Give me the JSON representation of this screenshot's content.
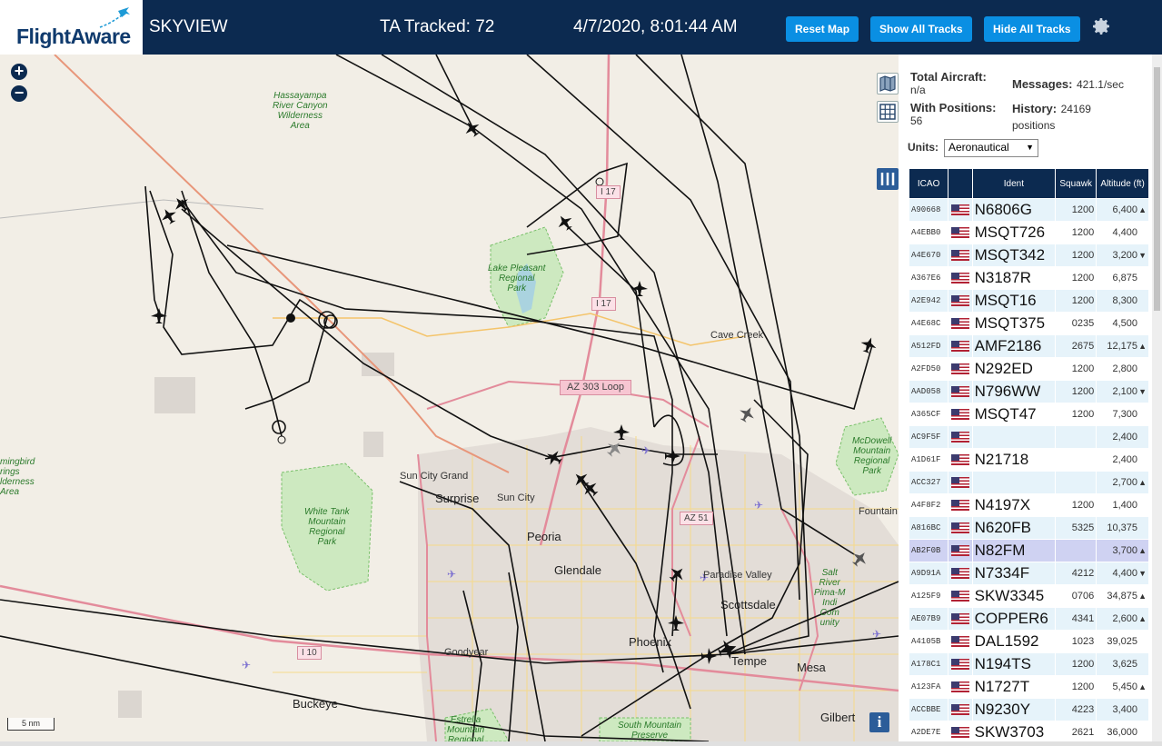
{
  "header": {
    "logo_text": "FlightAware",
    "app_title": "SKYVIEW",
    "tracked": "TA Tracked: 72",
    "clock": "4/7/2020, 8:01:44 AM",
    "reset_label": "Reset Map",
    "show_label": "Show All Tracks",
    "hide_label": "Hide All Tracks"
  },
  "map": {
    "scale_label": "5 nm",
    "info_label": "i",
    "labels": {
      "cave_creek": "Cave Creek",
      "sun_city_grand": "Sun City Grand",
      "surprise": "Surprise",
      "sun_city": "Sun City",
      "peoria": "Peoria",
      "glendale": "Glendale",
      "paradise_valley": "Paradise Valley",
      "scottsdale": "Scottsdale",
      "phoenix": "Phoenix",
      "tempe": "Tempe",
      "mesa": "Mesa",
      "goodyear": "Goodyear",
      "buckeye": "Buckeye",
      "gilbert": "Gilbert",
      "fountain": "Fountain",
      "hassayampa": "Hassayampa\nRiver Canyon\nWilderness\nArea",
      "lake_pleasant": "Lake Pleasant\nRegional\nPark",
      "white_tank": "White Tank\nMountain\nRegional\nPark",
      "mcdowell": "McDowell\nMountain\nRegional\nPark",
      "estrella": "Estrella\nMountain\nRegional",
      "south_mountain": "South Mountain\nPreserve",
      "hummingbird": "mingbird\nrings\nlderness\nArea",
      "salt_river": "Salt\nRiver\nPima-M\nIndi\nCom\nunity"
    },
    "shields": {
      "i17_top": "I 17",
      "i17_mid": "I 17",
      "az303": "AZ 303 Loop",
      "az51": "AZ 51",
      "i10": "I 10"
    }
  },
  "panel": {
    "total_aircraft_label": "Total Aircraft:",
    "total_aircraft_value": "n/a",
    "messages_label": "Messages:",
    "messages_value": "421.1/sec",
    "with_positions_label": "With Positions:",
    "with_positions_value": "56",
    "history_label": "History:",
    "history_value": "24169 positions",
    "units_label": "Units:",
    "units_value": "Aeronautical",
    "columns": [
      "ICAO",
      "",
      "Ident",
      "Squawk",
      "Altitude (ft)"
    ],
    "rows": [
      {
        "icao": "A90668",
        "ident": "N6806G",
        "squawk": "1200",
        "alt": "6,400",
        "trend": "▲"
      },
      {
        "icao": "A4EBB0",
        "ident": "MSQT726",
        "squawk": "1200",
        "alt": "4,400",
        "trend": ""
      },
      {
        "icao": "A4E670",
        "ident": "MSQT342",
        "squawk": "1200",
        "alt": "3,200",
        "trend": "▼"
      },
      {
        "icao": "A367E6",
        "ident": "N3187R",
        "squawk": "1200",
        "alt": "6,875",
        "trend": ""
      },
      {
        "icao": "A2E942",
        "ident": "MSQT16",
        "squawk": "1200",
        "alt": "8,300",
        "trend": ""
      },
      {
        "icao": "A4E68C",
        "ident": "MSQT375",
        "squawk": "0235",
        "alt": "4,500",
        "trend": ""
      },
      {
        "icao": "A512FD",
        "ident": "AMF2186",
        "squawk": "2675",
        "alt": "12,175",
        "trend": "▲"
      },
      {
        "icao": "A2FD50",
        "ident": "N292ED",
        "squawk": "1200",
        "alt": "2,800",
        "trend": ""
      },
      {
        "icao": "AAD058",
        "ident": "N796WW",
        "squawk": "1200",
        "alt": "2,100",
        "trend": "▼"
      },
      {
        "icao": "A365CF",
        "ident": "MSQT47",
        "squawk": "1200",
        "alt": "7,300",
        "trend": ""
      },
      {
        "icao": "AC9F5F",
        "ident": "",
        "squawk": "",
        "alt": "2,400",
        "trend": ""
      },
      {
        "icao": "A1D61F",
        "ident": "N21718",
        "squawk": "",
        "alt": "2,400",
        "trend": ""
      },
      {
        "icao": "ACC327",
        "ident": "",
        "squawk": "",
        "alt": "2,700",
        "trend": "▲"
      },
      {
        "icao": "A4F8F2",
        "ident": "N4197X",
        "squawk": "1200",
        "alt": "1,400",
        "trend": ""
      },
      {
        "icao": "A816BC",
        "ident": "N620FB",
        "squawk": "5325",
        "alt": "10,375",
        "trend": ""
      },
      {
        "icao": "AB2F0B",
        "ident": "N82FM",
        "squawk": "",
        "alt": "3,700",
        "trend": "▲",
        "selected": true
      },
      {
        "icao": "A9D91A",
        "ident": "N7334F",
        "squawk": "4212",
        "alt": "4,400",
        "trend": "▼"
      },
      {
        "icao": "A125F9",
        "ident": "SKW3345",
        "squawk": "0706",
        "alt": "34,875",
        "trend": "▲"
      },
      {
        "icao": "AE07B9",
        "ident": "COPPER6",
        "squawk": "4341",
        "alt": "2,600",
        "trend": "▲"
      },
      {
        "icao": "A4105B",
        "ident": "DAL1592",
        "squawk": "1023",
        "alt": "39,025",
        "trend": ""
      },
      {
        "icao": "A178C1",
        "ident": "N194TS",
        "squawk": "1200",
        "alt": "3,625",
        "trend": ""
      },
      {
        "icao": "A123FA",
        "ident": "N1727T",
        "squawk": "1200",
        "alt": "5,450",
        "trend": "▲"
      },
      {
        "icao": "ACCBBE",
        "ident": "N9230Y",
        "squawk": "4223",
        "alt": "3,400",
        "trend": ""
      },
      {
        "icao": "A2DE7E",
        "ident": "SKW3703",
        "squawk": "2621",
        "alt": "36,000",
        "trend": ""
      }
    ]
  }
}
